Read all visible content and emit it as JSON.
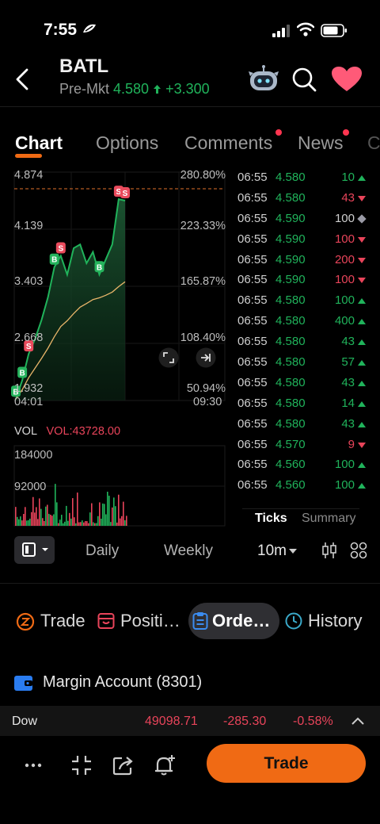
{
  "status_bar": {
    "time": "7:55"
  },
  "header": {
    "ticker": "BATL",
    "premkt_label": "Pre-Mkt",
    "premkt_price": "4.580",
    "premkt_change": "+3.300"
  },
  "tabs": [
    "Chart",
    "Options",
    "Comments",
    "News",
    "C"
  ],
  "chart": {
    "price_labels": [
      "4.874",
      "4.139",
      "3.403",
      "2.668",
      "1.932"
    ],
    "pct_labels": [
      "280.80%",
      "223.33%",
      "165.87%",
      "108.40%",
      "50.94%"
    ],
    "time_start": "04:01",
    "time_end": "09:30",
    "vol_label": "VOL",
    "vol_value": "VOL:43728.00",
    "vol_ticks": [
      "184000",
      "92000"
    ]
  },
  "chart_data": {
    "type": "area",
    "title": "",
    "xlabel": "",
    "ylabel": "",
    "x": [
      "04:01",
      "09:30"
    ],
    "ylim": [
      1.932,
      4.874
    ],
    "series": [
      {
        "values": [
          1.95,
          2.2,
          2.55,
          2.75,
          3.0,
          3.3,
          3.7,
          3.85,
          3.6,
          3.95,
          4.0,
          3.75,
          3.9,
          3.6,
          3.8,
          4.0,
          4.6,
          4.58
        ]
      }
    ],
    "volume_ylim": [
      0,
      184000
    ],
    "markers": [
      "B",
      "S",
      "B",
      "B",
      "S",
      "B",
      "S",
      "S"
    ]
  },
  "ticks": [
    {
      "time": "06:55",
      "price": "4.580",
      "vol": "10",
      "dir": "up"
    },
    {
      "time": "06:55",
      "price": "4.580",
      "vol": "43",
      "dir": "down"
    },
    {
      "time": "06:55",
      "price": "4.590",
      "vol": "100",
      "dir": "flat"
    },
    {
      "time": "06:55",
      "price": "4.590",
      "vol": "100",
      "dir": "down"
    },
    {
      "time": "06:55",
      "price": "4.590",
      "vol": "200",
      "dir": "down"
    },
    {
      "time": "06:55",
      "price": "4.590",
      "vol": "100",
      "dir": "down"
    },
    {
      "time": "06:55",
      "price": "4.580",
      "vol": "100",
      "dir": "up"
    },
    {
      "time": "06:55",
      "price": "4.580",
      "vol": "400",
      "dir": "up"
    },
    {
      "time": "06:55",
      "price": "4.580",
      "vol": "43",
      "dir": "up"
    },
    {
      "time": "06:55",
      "price": "4.580",
      "vol": "57",
      "dir": "up"
    },
    {
      "time": "06:55",
      "price": "4.580",
      "vol": "43",
      "dir": "up"
    },
    {
      "time": "06:55",
      "price": "4.580",
      "vol": "14",
      "dir": "up"
    },
    {
      "time": "06:55",
      "price": "4.580",
      "vol": "43",
      "dir": "up"
    },
    {
      "time": "06:55",
      "price": "4.570",
      "vol": "9",
      "dir": "down"
    },
    {
      "time": "06:55",
      "price": "4.560",
      "vol": "100",
      "dir": "up"
    },
    {
      "time": "06:55",
      "price": "4.560",
      "vol": "100",
      "dir": "up"
    }
  ],
  "ticks_tabs": [
    "Ticks",
    "Summary"
  ],
  "periods": {
    "daily": "Daily",
    "weekly": "Weekly",
    "interval": "10m"
  },
  "order_tabs": [
    "Trade",
    "Positi…",
    "Orde…",
    "History"
  ],
  "margin_account": "Margin Account (8301)",
  "index_bar": {
    "name": "Dow",
    "value": "49098.71",
    "change": "-285.30",
    "pct": "-0.58%"
  },
  "trade_button": "Trade",
  "colors": {
    "accent": "#f06a14",
    "up": "#20b35b",
    "down": "#e8445a",
    "background": "#000000"
  }
}
